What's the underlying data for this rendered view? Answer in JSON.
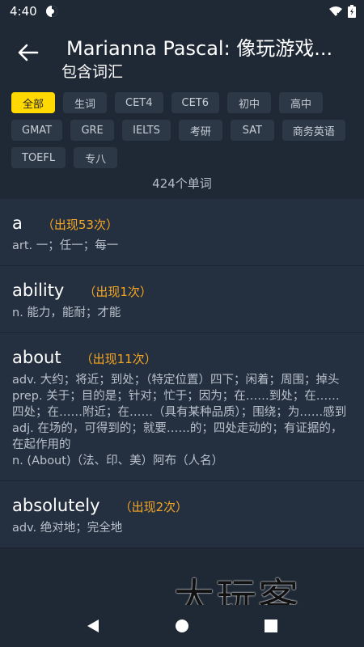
{
  "status": {
    "time": "4:40"
  },
  "header": {
    "title": "Marianna Pascal: 像玩游戏...",
    "subtitle": "包含词汇"
  },
  "filters": [
    {
      "label": "全部",
      "active": true
    },
    {
      "label": "生词"
    },
    {
      "label": "CET4"
    },
    {
      "label": "CET6"
    },
    {
      "label": "初中"
    },
    {
      "label": "高中"
    },
    {
      "label": "GMAT"
    },
    {
      "label": "GRE"
    },
    {
      "label": "IELTS"
    },
    {
      "label": "考研"
    },
    {
      "label": "SAT"
    },
    {
      "label": "商务英语"
    },
    {
      "label": "TOEFL"
    },
    {
      "label": "专八"
    }
  ],
  "summary": {
    "count_text": "424个单词"
  },
  "words": [
    {
      "word": "a",
      "freq": "（出现53次）",
      "defs": [
        "art. 一；任一；每一"
      ]
    },
    {
      "word": "ability",
      "freq": "（出现1次）",
      "defs": [
        "n. 能力，能耐；才能"
      ]
    },
    {
      "word": "about",
      "freq": "（出现11次）",
      "defs": [
        "adv. 大约；将近；到处；（特定位置）四下；闲着；周围；掉头",
        "prep. 关于；目的是；针对；忙于；因为；在……到处；在……四处；在……附近；在……（具有某种品质）；围绕；为……感到",
        "adj. 在场的，可得到的；就要……的；四处走动的；有证据的，在起作用的",
        "n. (About)（法、印、美）阿布（人名）"
      ]
    },
    {
      "word": "absolutely",
      "freq": "（出现2次）",
      "defs": [
        "adv. 绝对地；完全地"
      ]
    }
  ],
  "watermark": "大玩客",
  "colors": {
    "background": "#1f2936",
    "card": "#243040",
    "chip": "#2c3846",
    "chip_active": "#ffd900",
    "freq": "#f5a623"
  }
}
